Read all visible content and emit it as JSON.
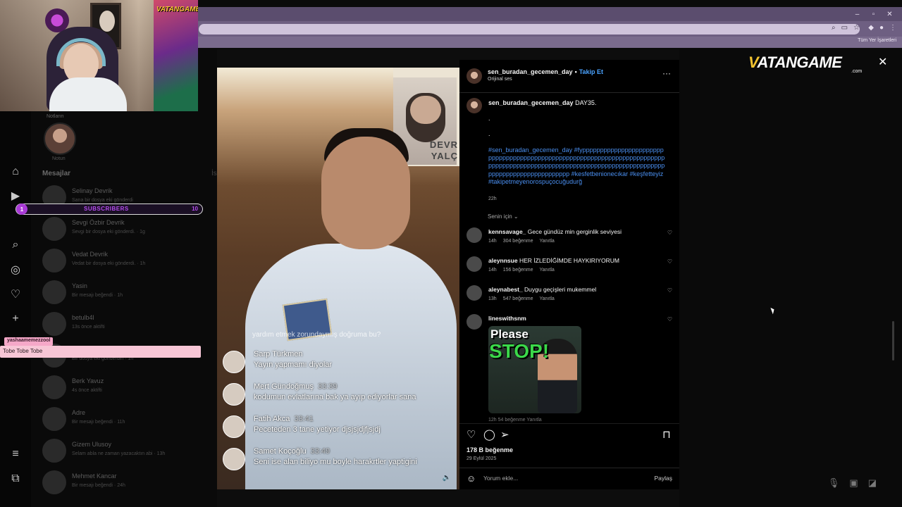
{
  "browser": {
    "bookmarks_all": "Tüm Yer İşaretleri",
    "window_buttons": [
      "–",
      "▫",
      "✕"
    ]
  },
  "stream_overlay": {
    "brand_small": "VATANGAME",
    "subscribers": {
      "count": "1",
      "label": "SUBSCRIBERS",
      "goal": "10"
    },
    "chat": {
      "username": "yashaamemezzool",
      "message": "Tobe Tobe Tobe"
    }
  },
  "messages_panel": {
    "notes_label": "Notların",
    "note_user": "Notun",
    "title": "Mesajlar",
    "requests": "İs",
    "conversations": [
      {
        "name": "Selinay Devrik",
        "sub": "Sana bir dosya eki gönderdi"
      },
      {
        "name": "Sevgi Özbir Devrik",
        "sub": "Sevgi bir dosya eki gönderdi. · 1g"
      },
      {
        "name": "Vedat Devrik",
        "sub": "Vedat bir dosya eki gönderdi. · 1h"
      },
      {
        "name": "Yasin",
        "sub": "Bir mesajı beğendi · 1h"
      },
      {
        "name": "betulb4l",
        "sub": "13s önce aktifti"
      },
      {
        "name": "",
        "sub": "Bir dosya eki gönderdin · 1h"
      },
      {
        "name": "Berk Yavuz",
        "sub": "4s önce aktifti"
      },
      {
        "name": "Adre",
        "sub": "Bir mesajı beğendi · 11h"
      },
      {
        "name": "Gizem Ulusoy",
        "sub": "Selam abla ne zaman yazacaktın abi · 13h"
      },
      {
        "name": "Mehmet Kancar",
        "sub": "Bir mesajı beğendi · 24h"
      }
    ]
  },
  "reel": {
    "overlay_text_top": "DEVR",
    "overlay_text_bottom": "YALÇ",
    "caption_partial": "yardım etmek zorundaymış doğruma bu?",
    "live_comments": [
      {
        "name": "Sarp Türkmen",
        "time": "",
        "text": "Yayın yapmamı diyolar"
      },
      {
        "name": "Mert Gündoğmuş",
        "time": "33:39",
        "text": "kodumun evlatlarına bak ya ayıp ediyorlar sana"
      },
      {
        "name": "Fatih Akca",
        "time": "33:41",
        "text": "Peceteden 3 tane yetiyor djsjsjdjfjsjdj"
      },
      {
        "name": "Samet Koçoğlu",
        "time": "33:49",
        "text": "Seni ise alan biliyo mu boyle harakrtler yaptigini"
      }
    ]
  },
  "post": {
    "username": "sen_buradan_gecemen_day",
    "follow": "Takip Et",
    "audio": "Orijinal ses",
    "caption_user": "sen_buradan_gecemen_day",
    "caption_text": "DAY35.",
    "caption_dots": [
      ".",
      "."
    ],
    "hashtags": "#sen_buradan_gecemen_day #fypppppppppppppppppppppppppppppppppppppppppppppppppppppppppppppppppppppppppppppppppppppppppppppppppppppppppppppppppppppppppppppppppppppppppppppppppp #kesfetbenionecıkar #keşfetteyiz #takipetmeyenorospuçocuğudurğ",
    "caption_time": "22h",
    "for_you": "Senin için",
    "comments": [
      {
        "user": "kennsavage_",
        "text": "Gece gündüz min gerginlik seviyesi",
        "time": "14h",
        "likes": "304 beğenme",
        "reply": "Yanıtla"
      },
      {
        "user": "aleynnsue",
        "text": "HER İZLEDİĞİMDE HAYKIRIYORUM",
        "time": "14h",
        "likes": "156 beğenme",
        "reply": "Yanıtla"
      },
      {
        "user": "aleynabest_",
        "text": "Duygu geçişleri mukemmel",
        "time": "13h",
        "likes": "547 beğenme",
        "reply": "Yanıtla"
      },
      {
        "user": "lineswithsnm",
        "text": "",
        "time": "",
        "likes": "",
        "reply": ""
      }
    ],
    "gif_line1": "Please",
    "gif_line2": "STOP!",
    "gif_meta": "12h   54 beğenme   Yanıtla",
    "likes_total": "178 B beğenme",
    "date": "29 Eylül 2025",
    "add_comment_placeholder": "Yorum ekle...",
    "share": "Paylaş"
  },
  "brand": {
    "name": "VATANGAME",
    "v": "V",
    "rest": "ATANGAME",
    "domain": ".com"
  },
  "colors": {
    "link_blue": "#4aa3ff",
    "hashtag": "#4a8ff0",
    "subs_purple": "#b64df0",
    "browser_purple": "#6e5f82"
  },
  "icons": [
    "home-icon",
    "reels-icon",
    "search-icon",
    "explore-icon",
    "heart-icon",
    "create-icon",
    "menu-icon",
    "more-icon",
    "like-icon",
    "comment-icon",
    "share-icon",
    "bookmark-icon",
    "emoji-icon",
    "mic-icon",
    "image-icon",
    "sticker-icon",
    "close-icon"
  ]
}
